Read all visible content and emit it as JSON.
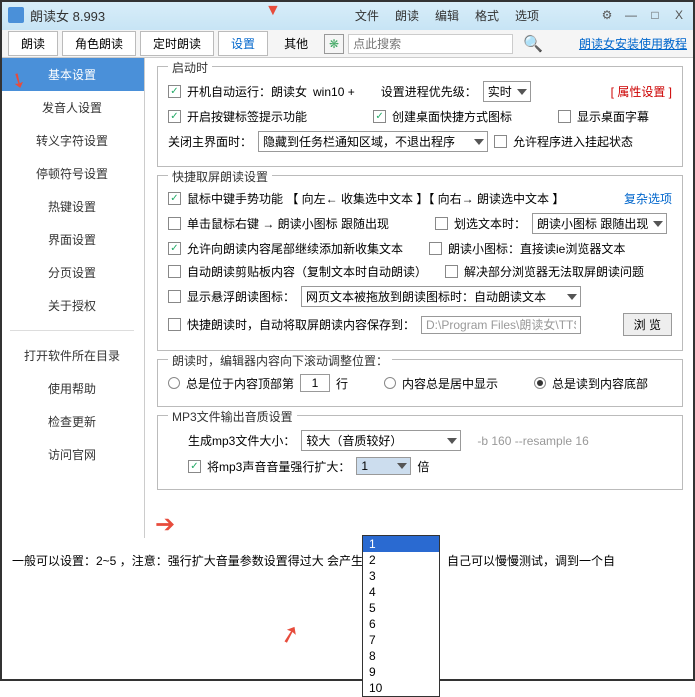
{
  "app": {
    "title": "朗读女 8.993"
  },
  "menu": {
    "file": "文件",
    "read": "朗读",
    "edit": "编辑",
    "format": "格式",
    "options": "选项"
  },
  "win": {
    "gear": "⚙",
    "min": "—",
    "max": "□",
    "close": "X"
  },
  "toolbar": {
    "read": "朗读",
    "role": "角色朗读",
    "timed": "定时朗读",
    "settings": "设置",
    "other": "其他",
    "search_placeholder": "点此搜索",
    "help": "朗读女安装使用教程"
  },
  "sidebar": {
    "items": [
      "基本设置",
      "发音人设置",
      "转义字符设置",
      "停顿符号设置",
      "热键设置",
      "界面设置",
      "分页设置",
      "关于授权"
    ],
    "group2": [
      "打开软件所在目录",
      "使用帮助",
      "检查更新",
      "访问官网"
    ]
  },
  "startup": {
    "title": "启动时",
    "auto_run": "开机自动运行：朗读女",
    "win10": "win10 +",
    "priority_label": "设置进程优先级：",
    "priority_value": "实时",
    "attr": "[ 属性设置 ]",
    "taskbar_tip": "开启按键标签提示功能",
    "desktop_shortcut": "创建桌面快捷方式图标",
    "desktop_subtitle": "显示桌面字幕",
    "close_label": "关闭主界面时：",
    "close_value": "隐藏到任务栏通知区域，不退出程序",
    "allow_suspend": "允许程序进入挂起状态"
  },
  "quick": {
    "title": "快捷取屏朗读设置",
    "complex": "复杂选项",
    "middle_gesture": "鼠标中键手势功能 【 向左← 收集选中文本 】【 向右→ 朗读选中文本 】",
    "right_click": "单击鼠标右键 → 朗读小图标 跟随出现",
    "select_text": "划选文本时：",
    "select_value": "朗读小图标 跟随出现",
    "tail_append": "允许向朗读内容尾部继续添加新收集文本",
    "small_icon": "朗读小图标：直接读ie浏览器文本",
    "auto_clipboard": "自动朗读剪贴板内容（复制文本时自动朗读）",
    "fix_browser": "解决部分浏览器无法取屏朗读问题",
    "float_label": "显示悬浮朗读图标：",
    "float_value": "网页文本被拖放到朗读图标时：自动朗读文本",
    "fast_save": "快捷朗读时，自动将取屏朗读内容保存到：",
    "save_path": "D:\\Program Files\\朗读女\\TTSini",
    "browse": "浏 览"
  },
  "scroll": {
    "title": "朗读时，编辑器内容向下滚动调整位置：",
    "opt1": "总是位于内容顶部第",
    "line_val": "1",
    "line_suffix": "行",
    "opt2": "内容总是居中显示",
    "opt3": "总是读到内容底部"
  },
  "mp3": {
    "title": "MP3文件输出音质设置",
    "size_label": "生成mp3文件大小：",
    "size_value": "较大（音质较好）",
    "cmd": "-b 160 --resample 16",
    "amplify": "将mp3声音音量强行扩大：",
    "amplify_value": "1",
    "times": "倍",
    "options": [
      "1",
      "2",
      "3",
      "4",
      "5",
      "6",
      "7",
      "8",
      "9",
      "10"
    ]
  },
  "footer": "一般可以设置：2~5 ，注意：强行扩大音量参数设置得过大     会产生比较大的噪音。自己可以慢慢测试，调到一个自"
}
